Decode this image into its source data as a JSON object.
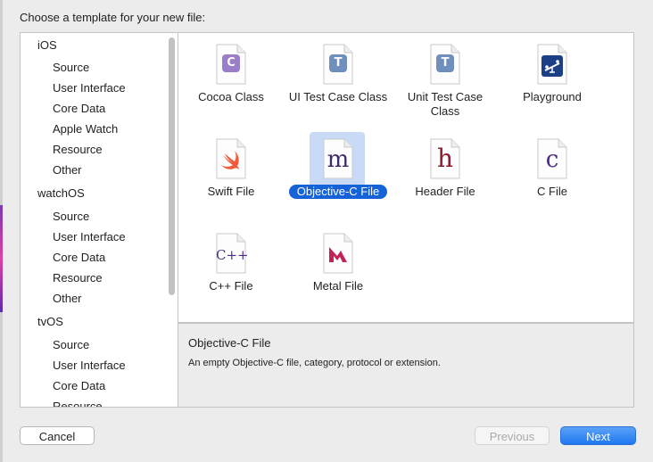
{
  "dialog": {
    "prompt": "Choose a template for your new file:"
  },
  "sidebar": {
    "groups": [
      {
        "platform": "iOS",
        "items": [
          "Source",
          "User Interface",
          "Core Data",
          "Apple Watch",
          "Resource",
          "Other"
        ]
      },
      {
        "platform": "watchOS",
        "items": [
          "Source",
          "User Interface",
          "Core Data",
          "Resource",
          "Other"
        ]
      },
      {
        "platform": "tvOS",
        "items": [
          "Source",
          "User Interface",
          "Core Data",
          "Resource"
        ]
      }
    ]
  },
  "templates": [
    {
      "label": "Cocoa Class",
      "icon": "cocoa-class-icon",
      "glyph": "C"
    },
    {
      "label": "UI Test Case Class",
      "icon": "ui-test-case-class-icon",
      "glyph": "T"
    },
    {
      "label": "Unit Test Case Class",
      "icon": "unit-test-case-class-icon",
      "glyph": "T"
    },
    {
      "label": "Playground",
      "icon": "playground-icon",
      "glyph": ""
    },
    {
      "label": "Swift File",
      "icon": "swift-file-icon",
      "glyph": ""
    },
    {
      "label": "Objective-C File",
      "icon": "objective-c-file-icon",
      "glyph": "m",
      "selected": true
    },
    {
      "label": "Header File",
      "icon": "header-file-icon",
      "glyph": "h"
    },
    {
      "label": "C File",
      "icon": "c-file-icon",
      "glyph": "c"
    },
    {
      "label": "C++ File",
      "icon": "cpp-file-icon",
      "glyph": "C++"
    },
    {
      "label": "Metal File",
      "icon": "metal-file-icon",
      "glyph": ""
    }
  ],
  "description": {
    "title": "Objective-C File",
    "text": "An empty Objective-C file, category, protocol or extension."
  },
  "buttons": {
    "cancel": "Cancel",
    "previous": "Previous",
    "next": "Next"
  },
  "colors": {
    "selection": "#1662d9",
    "selection_tile_bg": "#c9daf7",
    "next_button": "#1f77f0"
  }
}
